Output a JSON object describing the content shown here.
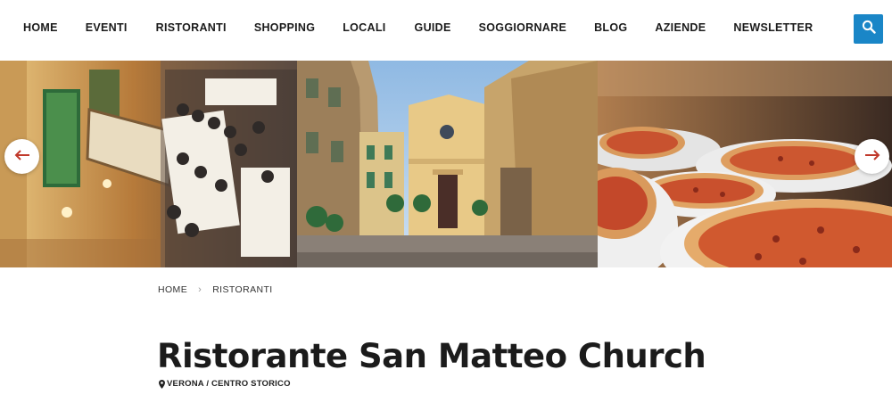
{
  "nav": {
    "items": [
      {
        "label": "HOME"
      },
      {
        "label": "EVENTI"
      },
      {
        "label": "RISTORANTI"
      },
      {
        "label": "SHOPPING"
      },
      {
        "label": "LOCALI"
      },
      {
        "label": "GUIDE"
      },
      {
        "label": "SOGGIORNARE"
      },
      {
        "label": "BLOG"
      },
      {
        "label": "AZIENDE"
      },
      {
        "label": "NEWSLETTER"
      }
    ],
    "search_icon": "search-icon"
  },
  "slider": {
    "prev_icon": "arrow-left-icon",
    "next_icon": "arrow-right-icon"
  },
  "breadcrumb": {
    "items": [
      {
        "label": "HOME"
      },
      {
        "label": "RISTORANTI"
      }
    ],
    "separator": "›"
  },
  "page": {
    "title": "Ristorante San Matteo Church",
    "location": "VERONA / CENTRO STORICO"
  },
  "colors": {
    "accent": "#1a86c7",
    "arrow": "#c0392b",
    "text": "#1b1b1b"
  }
}
